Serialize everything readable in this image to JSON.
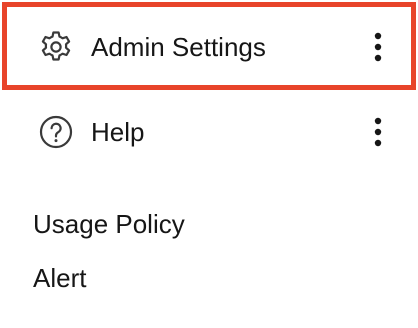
{
  "menu": {
    "items": [
      {
        "label": "Admin Settings",
        "icon": "gear-icon",
        "has_more": true,
        "highlighted": true
      },
      {
        "label": "Help",
        "icon": "help-circle-icon",
        "has_more": true,
        "highlighted": false
      }
    ],
    "links": [
      {
        "label": "Usage Policy"
      },
      {
        "label": "Alert"
      }
    ]
  },
  "colors": {
    "highlight_border": "#e8442a",
    "text": "#161616",
    "icon": "#3a3a3a"
  }
}
